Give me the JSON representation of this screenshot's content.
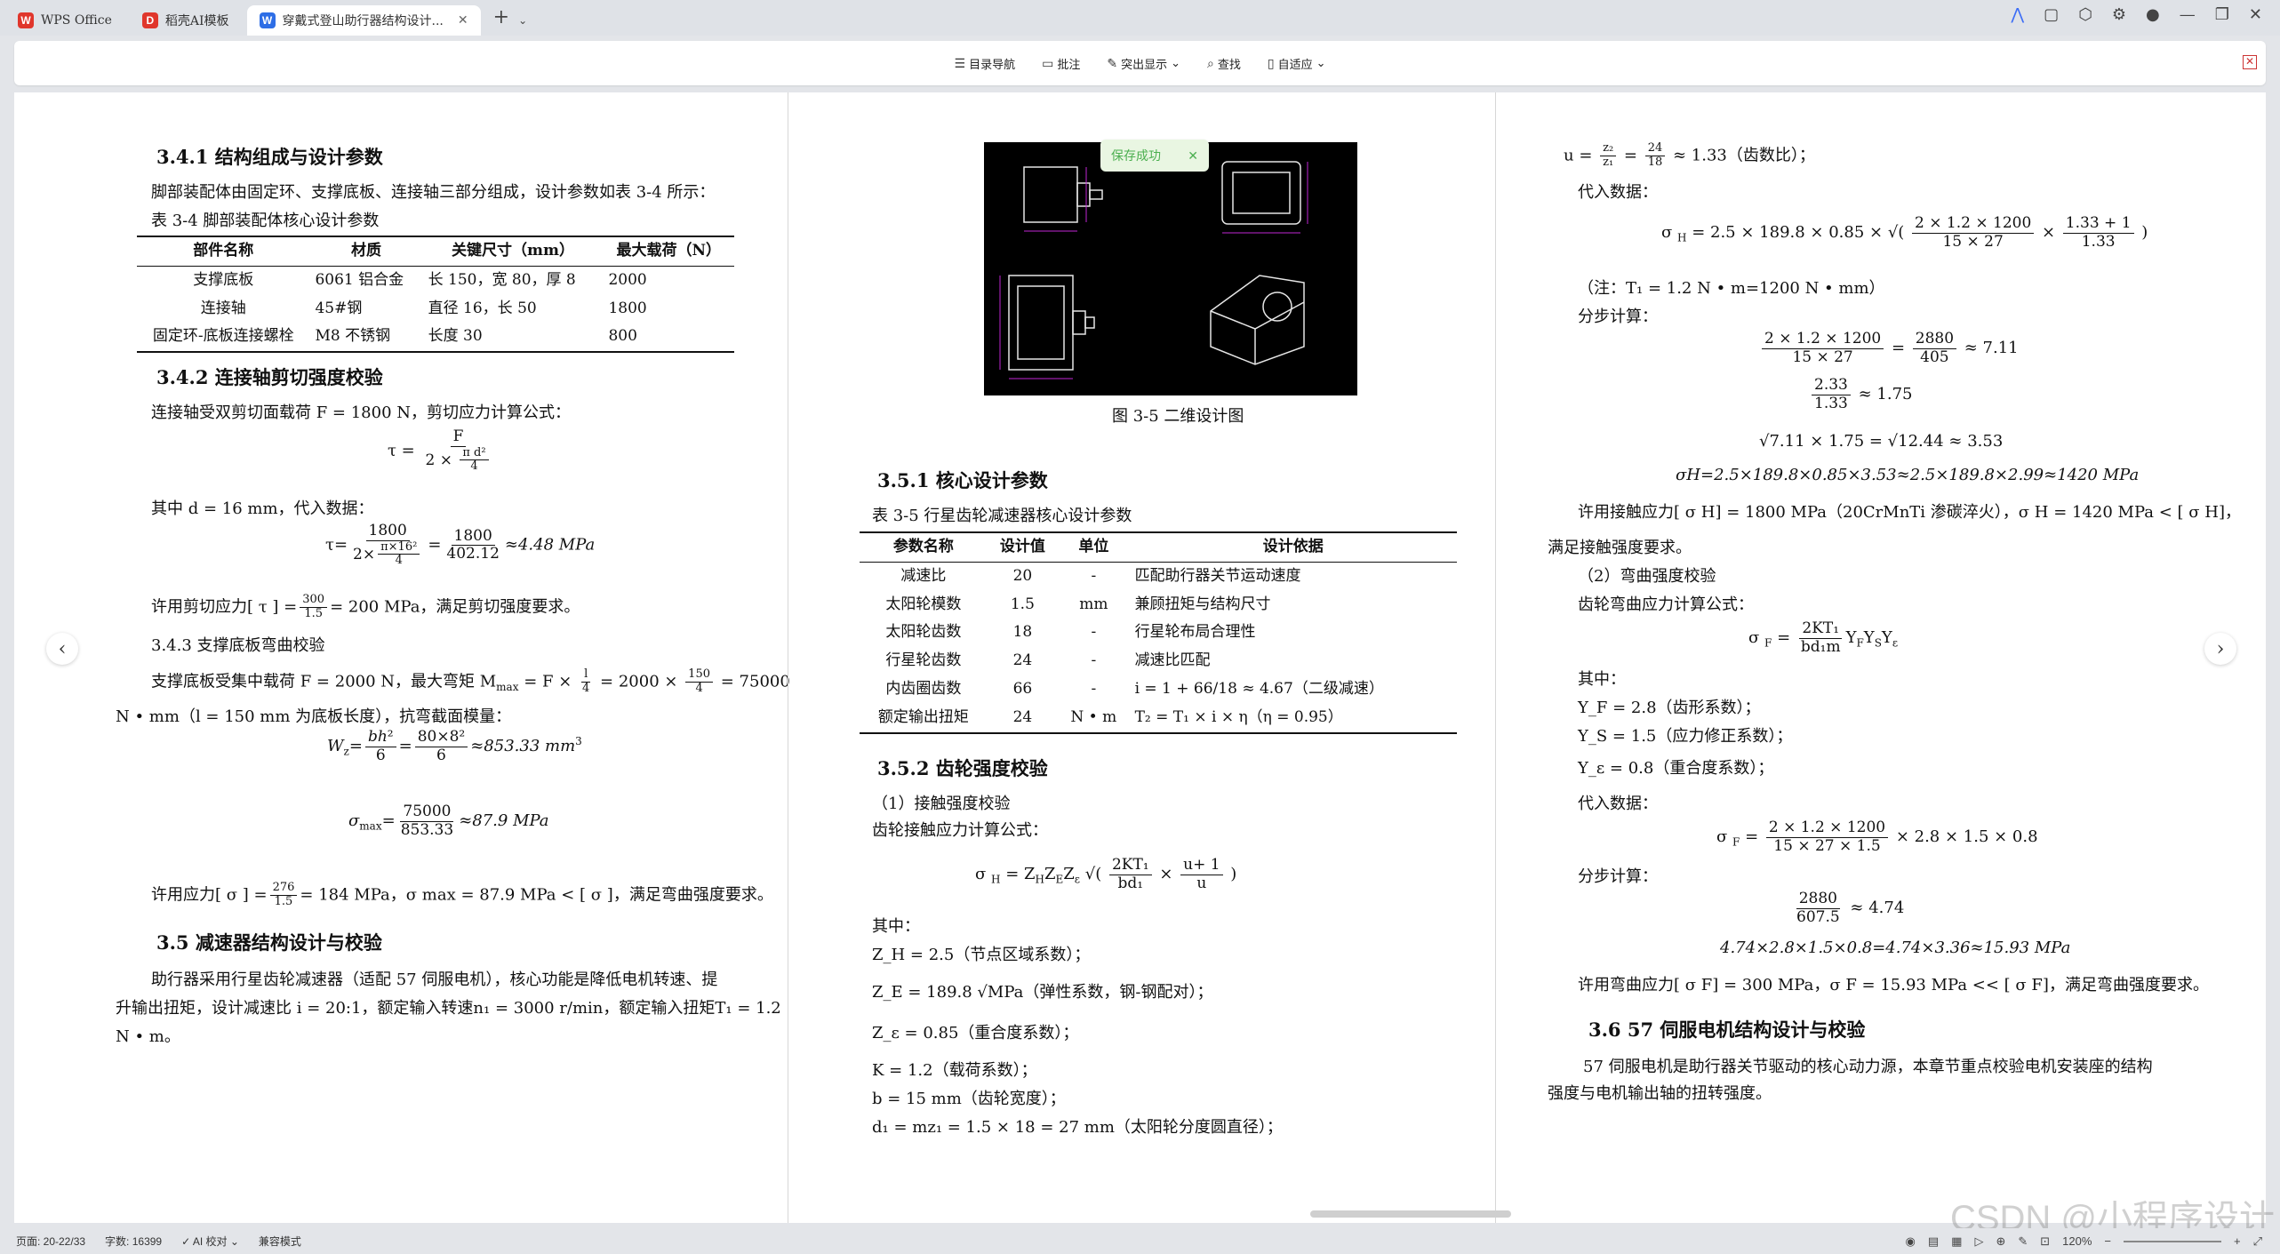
{
  "tabs": [
    {
      "label": "WPS Office",
      "logo": "W",
      "color": "#e0362c"
    },
    {
      "label": "稻壳AI模板",
      "logo": "D",
      "color": "#e0362c"
    },
    {
      "label": "穿戴式登山助行器结构设计...",
      "logo": "W",
      "color": "#2e6ee6"
    }
  ],
  "toolbar": {
    "toc": "目录导航",
    "annotate": "批注",
    "highlight": "突出显示",
    "find": "查找",
    "adapt": "自适应"
  },
  "toast": "保存成功",
  "page1": {
    "h341": "3.4.1 结构组成与设计参数",
    "intro": "脚部装配体由固定环、支撑底板、连接轴三部分组成，设计参数如表 3-4 所示：",
    "table_caption": "表 3-4 脚部装配体核心设计参数",
    "table_headers": [
      "部件名称",
      "材质",
      "关键尺寸（mm）",
      "最大载荷（N）"
    ],
    "table_rows": [
      [
        "支撑底板",
        "6061 铝合金",
        "长 150，宽 80，厚 8",
        "2000"
      ],
      [
        "连接轴",
        "45#钢",
        "直径 16，长 50",
        "1800"
      ],
      [
        "固定环-底板连接螺栓",
        "M8 不锈钢",
        "长度 30",
        "800"
      ]
    ],
    "h342": "3.4.2 连接轴剪切强度校验",
    "shear_text": "连接轴受双剪切面载荷 F = 1800 N，剪切应力计算公式：",
    "where_d": "其中 d = 16 mm，代入数据：",
    "shear_result": "≈4.48 MPa",
    "allow_shear_pre": "许用剪切应力[ τ ] =",
    "allow_shear_post": "= 200 MPa，满足剪切强度要求。",
    "h343": "3.4.3 支撑底板弯曲校验",
    "bend_text1": "支撑底板受集中载荷 F = 2000 N，最大弯矩 M",
    "bend_text1b": "= 75000",
    "bend_text2": "N • mm（l = 150 mm 为底板长度），抗弯截面模量：",
    "wz_result": "≈853.33 mm",
    "sigma_result": "≈87.9 MPa",
    "allow_bend_pre": "许用应力[ σ ] =",
    "allow_bend_post": "= 184 MPa，σ max = 87.9 MPa < [ σ ]，满足弯曲强度要求。",
    "h35": "3.5 减速器结构设计与校验",
    "reducer1": "助行器采用行星齿轮减速器（适配 57 伺服电机），核心功能是降低电机转速、提",
    "reducer2": "升输出扭矩，设计减速比 i = 20:1，额定输入转速n₁ = 3000 r/min，额定输入扭矩T₁ = 1.2",
    "reducer3": "N • m。"
  },
  "page2": {
    "fig_caption": "图 3-5 二维设计图",
    "h351": "3.5.1 核心设计参数",
    "table_caption": "表 3-5 行星齿轮减速器核心设计参数",
    "table_headers": [
      "参数名称",
      "设计值",
      "单位",
      "设计依据"
    ],
    "table_rows": [
      [
        "减速比",
        "20",
        "-",
        "匹配助行器关节运动速度"
      ],
      [
        "太阳轮模数",
        "1.5",
        "mm",
        "兼顾扭矩与结构尺寸"
      ],
      [
        "太阳轮齿数",
        "18",
        "-",
        "行星轮布局合理性"
      ],
      [
        "行星轮齿数",
        "24",
        "-",
        "减速比匹配"
      ],
      [
        "内齿圈齿数",
        "66",
        "-",
        "i = 1 + 66/18 ≈ 4.67（二级减速）"
      ],
      [
        "额定输出扭矩",
        "24",
        "N • m",
        "T₂ = T₁ × i × η（η = 0.95）"
      ]
    ],
    "h352": "3.5.2 齿轮强度校验",
    "contact": "（1）接触强度校验",
    "contact_formula_label": "齿轮接触应力计算公式：",
    "where": "其中：",
    "zh": "Z_H = 2.5（节点区域系数）；",
    "ze": "Z_E = 189.8 √MPa（弹性系数，钢-钢配对）；",
    "zeps": "Z_ε = 0.85（重合度系数）；",
    "k": "K = 1.2（载荷系数）；",
    "b": "b = 15 mm（齿轮宽度）；",
    "d1": "d₁ = mz₁ = 1.5 × 18 = 27 mm（太阳轮分度圆直径）；"
  },
  "page3": {
    "u_line": "≈ 1.33（齿数比）；",
    "substitute": "代入数据：",
    "note": "（注：T₁ = 1.2 N • m=1200 N • mm）",
    "step": "分步计算：",
    "calc1": "≈ 7.11",
    "calc2": "≈ 1.75",
    "calc3": "√7.11 × 1.75 = √12.44 ≈ 3.53",
    "calc4": "σH=2.5×189.8×0.85×3.53≈2.5×189.8×2.99≈1420 MPa",
    "allow_contact": "许用接触应力[ σ H] = 1800 MPa（20CrMnTi 渗碳淬火），σ H = 1420 MPa < [ σ H]，",
    "allow_contact2": "满足接触强度要求。",
    "bending": "（2）弯曲强度校验",
    "bending_formula_label": "齿轮弯曲应力计算公式：",
    "where": "其中：",
    "yf": "Y_F = 2.8（齿形系数）；",
    "ys": "Y_S = 1.5（应力修正系数）；",
    "yeps": "Y_ε = 0.8（重合度系数）；",
    "substitute2": "代入数据：",
    "step2": "分步计算：",
    "calc5": "≈ 4.74",
    "calc6": "4.74×2.8×1.5×0.8=4.74×3.36≈15.93 MPa",
    "allow_bend": "许用弯曲应力[ σ F] = 300 MPa，σ F = 15.93 MPa << [ σ F]，满足弯曲强度要求。",
    "h36": "3.6 57 伺服电机结构设计与校验",
    "motor1": "57 伺服电机是助行器关节驱动的核心动力源，本章节重点校验电机安装座的结构",
    "motor2": "强度与电机输出轴的扭转强度。"
  },
  "statusbar": {
    "page": "页面: 20-22/33",
    "words": "字数: 16399",
    "ai": "AI 校对",
    "compat": "兼容模式",
    "zoom": "120%"
  },
  "watermark": "CSDN @小程序设计"
}
